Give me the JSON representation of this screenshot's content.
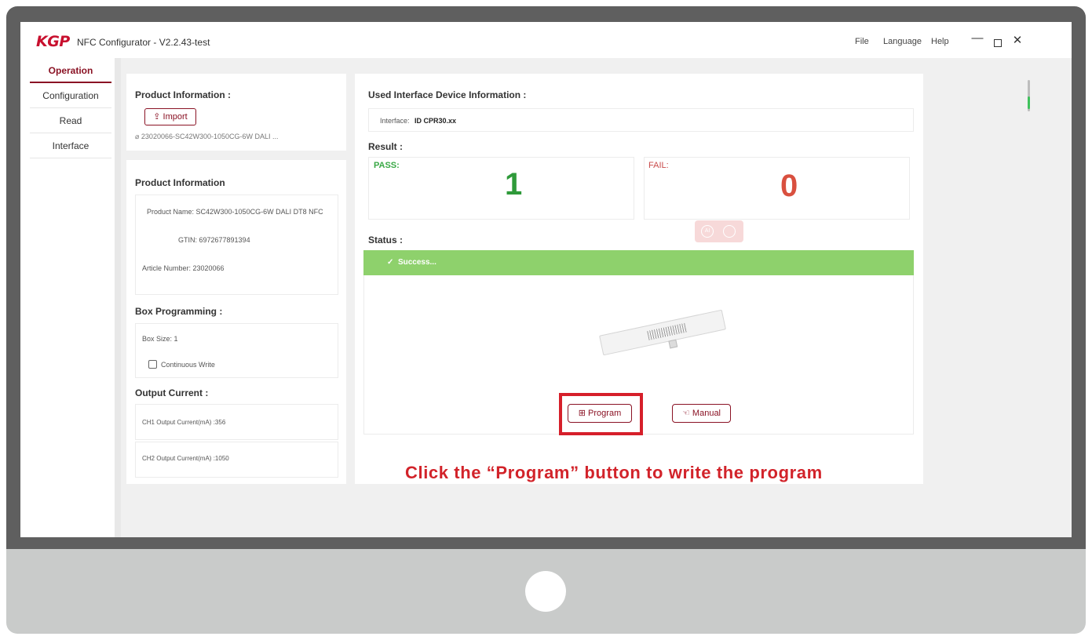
{
  "window": {
    "logo": "KGP",
    "title": "NFC Configurator - V2.2.43-test",
    "menu": [
      "File",
      "Language",
      "Help"
    ],
    "minimize": "—",
    "close": "✕"
  },
  "sidebar": {
    "items": [
      {
        "label": "Operation",
        "active": true
      },
      {
        "label": "Configuration",
        "active": false
      },
      {
        "label": "Read",
        "active": false
      },
      {
        "label": "Interface",
        "active": false
      }
    ]
  },
  "product_import": {
    "heading": "Product Information :",
    "import_label": "Import",
    "file_name": "23020066-SC42W300-1050CG-6W DALI ..."
  },
  "product_info": {
    "heading": "Product Information",
    "product_name": "Product Name:  SC42W300-1050CG-6W DALI DT8 NFC",
    "gtin": "GTIN:  6972677891394",
    "article_number": "Article Number:  23020066"
  },
  "box_programming": {
    "heading": "Box Programming :",
    "box_size": "Box Size:  1",
    "continuous_write": "Continuous Write"
  },
  "output_current": {
    "heading": "Output Current :",
    "ch1": "CH1 Output Current(mA) :356",
    "ch2": "CH2 Output Current(mA) :1050"
  },
  "interface_info": {
    "heading": "Used Interface Device Information :",
    "label": "Interface:",
    "value": "ID CPR30.xx"
  },
  "result": {
    "heading": "Result :",
    "pass_label": "PASS:",
    "pass_count": "1",
    "fail_label": "FAIL:",
    "fail_count": "0"
  },
  "status": {
    "heading": "Status :",
    "text": "Success...",
    "color": "#8ed16c"
  },
  "actions": {
    "program_label": "Program",
    "manual_label": "Manual"
  },
  "caption": "Click the “Program” button to write the program",
  "colors": {
    "brand": "#8a1224",
    "pass": "#2f9a3a",
    "fail": "#d9503f",
    "highlight": "#d61f2a"
  }
}
